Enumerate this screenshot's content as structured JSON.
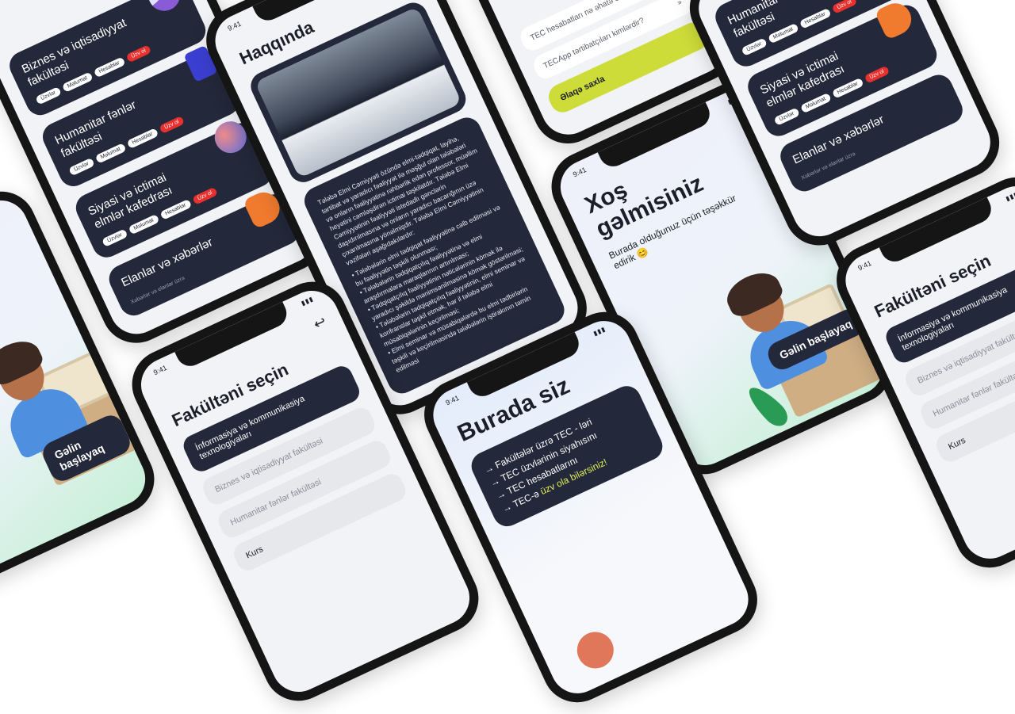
{
  "status_time": "9:41",
  "faculties_list": {
    "items": [
      {
        "title": "Biznes və iqtisadiyyat fakültəsi",
        "chips": [
          "Üzvlər",
          "Məlumat",
          "Hesablar",
          "Üzv ol"
        ]
      },
      {
        "title": "Humanitar fənlər fakültəsi",
        "chips": [
          "Üzvlər",
          "Məlumat",
          "Hesablar",
          "Üzv ol"
        ]
      },
      {
        "title": "Siyasi və ictimai elmlər kafedrası",
        "chips": [
          "Üzvlər",
          "Məlumat",
          "Hesablar",
          "Üzv ol"
        ]
      }
    ],
    "news_title": "Elanlar və xəbərlər",
    "news_sub": "Xəbərlər və elanlar üzrə"
  },
  "about": {
    "title": "Haqqında",
    "body": "Tələbə Elmi Cəmiyyəti özündə elmi-tədqiqat, layihə, tərtibat və yaradıcı fəaliyyət ilə məşğul olan tələbələri və onların fəaliyyətinə rəhbərlik edən professor, müəllim heyətini cəmləşdirən ictimai təşkilatdır. Tələbə Elmi Cəmiyyətinin fəaliyyəti istedadlı gənclərin daşıdırılmasına və onların yaradıcı bacarığının üzə çıxarılmasına yönəlmişdir. Tələbə Elmi Cəmiyyətinin vəzifələri aşağıdakılardır:",
    "bullets": [
      "Tələbələrin elmi tədqiqat fəaliyyətinə cəlb edilməsi və bu fəaliyyətin təşkili olunması;",
      "Tələbələrin tədqiqatçılıq fəaliyyətinə və elmi araşdırmalara maraqlarının artırılması;",
      "Tədqiqatçılıq fəaliyyətinin nəticələrinin kömək ilə yaradıcı şəkildə mənimsənilməsinə kömək göstərilməsi;",
      "Tələbələrin tədqiqatçılıq fəaliyyətinin, elmi seminar və konfranslar təşkil etmək, hər il tələbə elmi müsabiqələrinin keçirilməsi;",
      "Elmi seminar və müsabiqələrdə bu elmi tədbirlərin təşkili və keçirilməsində tələbələrin iştirakının təmin edilməsi"
    ]
  },
  "faq": {
    "q1": "TEC hesabatları nə əhatə edir?",
    "q2": "TECApp tərtibatçıları kimlərdir?",
    "contact_button": "Əlaqə saxla"
  },
  "welcome": {
    "title": "Xoş gəlmisiniz",
    "subtitle": "Burada olduğunuz üçün təşəkkür edirik 😊",
    "start_button": "Gəlin başlayaq"
  },
  "select_faculty": {
    "title": "Fakültəni seçin",
    "options": [
      "İnformasiya və kommunikasiya texnologiyaları",
      "Biznes və iqtisadiyyat fakültəsi",
      "Humanitar fənlər fakültəsi",
      "Kurs"
    ]
  },
  "here": {
    "title": "Burada siz",
    "lines": [
      "→ Fakültələr üzrə TEC - ləri",
      "→ TEC üzvlərinin siyahısını",
      "→ TEC hesabatlarını",
      "→ TEC-ə "
    ],
    "highlight": "üzv ola bilərsiniz!"
  },
  "colors": {
    "dark": "#23283a",
    "accent_yellow": "#cddc39",
    "badge_red": "#e8302f",
    "bg": "#f2f3f7"
  }
}
